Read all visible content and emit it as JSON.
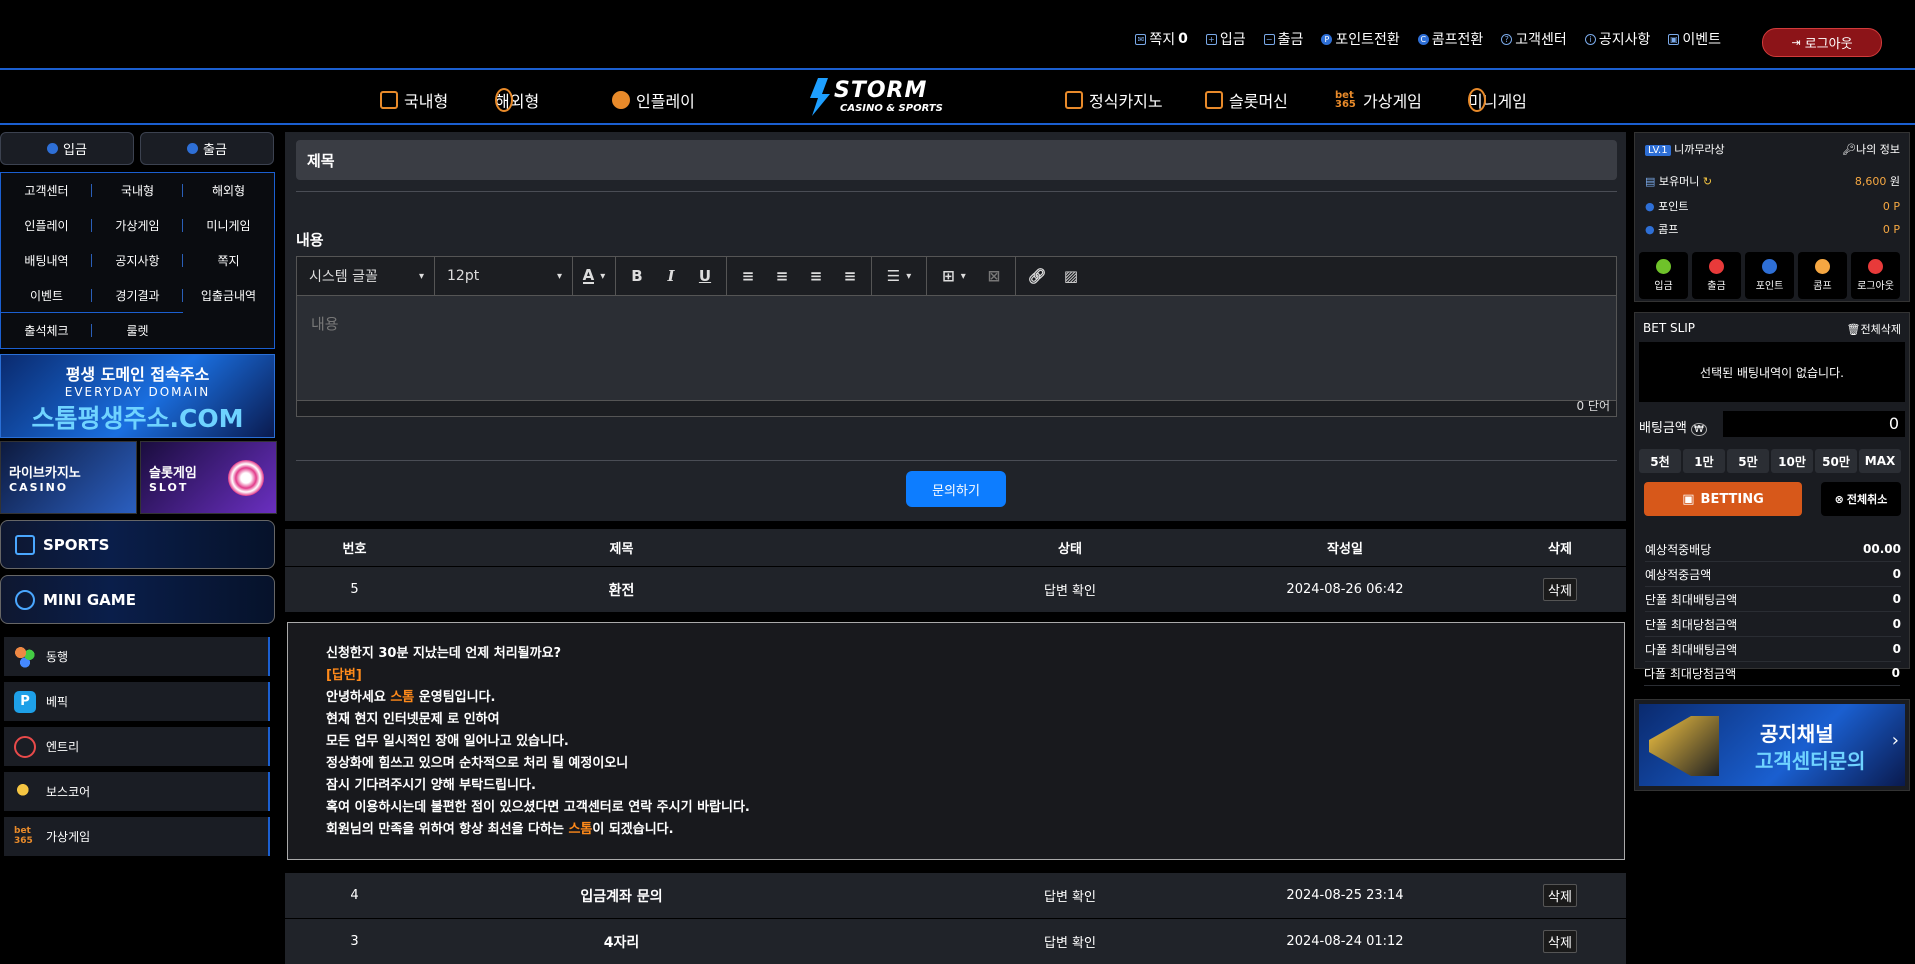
{
  "topnav": {
    "items": [
      {
        "label": "쪽지",
        "icon": "mail-icon",
        "count": "0"
      },
      {
        "label": "입금",
        "icon": "deposit-icon"
      },
      {
        "label": "출금",
        "icon": "withdraw-icon"
      },
      {
        "label": "포인트전환",
        "icon": "point-icon"
      },
      {
        "label": "콤프전환",
        "icon": "comp-icon"
      },
      {
        "label": "고객센터",
        "icon": "support-icon"
      },
      {
        "label": "공지사항",
        "icon": "notice-icon"
      },
      {
        "label": "이벤트",
        "icon": "gift-icon"
      }
    ],
    "logout_label": "로그아웃"
  },
  "mainnav": {
    "left": [
      {
        "label": "국내형"
      },
      {
        "label": "해외형"
      },
      {
        "label": "인플레이"
      }
    ],
    "right": [
      {
        "label": "정식카지노"
      },
      {
        "label": "슬롯머신"
      },
      {
        "label": "가상게임"
      },
      {
        "label": "미니게임"
      }
    ],
    "logo_main": "STORM",
    "logo_sub": "CASINO & SPORTS",
    "bet365": "bet 365"
  },
  "left": {
    "deposit": "입금",
    "withdraw": "출금",
    "grid": [
      "고객센터",
      "국내형",
      "해외형",
      "인플레이",
      "가상게임",
      "미니게임",
      "배팅내역",
      "공지사항",
      "쪽지",
      "이벤트",
      "경기결과",
      "입출금내역",
      "출석체크",
      "룰렛"
    ],
    "domain": {
      "line1": "평생 도메인 접속주소",
      "line2": "EVERYDAY DOMAIN",
      "line3": "스톰평생주소.COM"
    },
    "promo_casino": {
      "title": "라이브카지노",
      "sub": "CASINO"
    },
    "promo_slot": {
      "title": "슬롯게임",
      "sub": "SLOT"
    },
    "sports": "SPORTS",
    "minigame": "MINI GAME",
    "sites": [
      {
        "label": "동행"
      },
      {
        "label": "베픽"
      },
      {
        "label": "엔트리"
      },
      {
        "label": "보스코어"
      },
      {
        "label": "가상게임"
      }
    ]
  },
  "form": {
    "title_label": "제목",
    "content_label": "내용",
    "font_select": "시스템 글꼴",
    "size_select": "12pt",
    "placeholder": "내용",
    "wordcount": "0 단어",
    "submit": "문의하기"
  },
  "table": {
    "headers": [
      "번호",
      "제목",
      "상태",
      "작성일",
      "삭제"
    ],
    "rows": [
      {
        "no": "5",
        "title": "환전",
        "status": "답변 확인",
        "date": "2024-08-26 06:42",
        "del": "삭제"
      },
      {
        "no": "4",
        "title": "입금계좌 문의",
        "status": "답변 확인",
        "date": "2024-08-25 23:14",
        "del": "삭제"
      },
      {
        "no": "3",
        "title": "4자리",
        "status": "답변 확인",
        "date": "2024-08-24 01:12",
        "del": "삭제"
      }
    ],
    "answer": {
      "question": "신청한지 30분 지났는데 언제 처리될까요?",
      "tag": "[답변]",
      "l1_a": "안녕하세요 ",
      "l1_b": "스톰",
      "l1_c": " 운영팀입니다.",
      "l2": "현재 현지 인터넷문제 로 인하여",
      "l3": "모든 업무 일시적인 장애 일어나고 있습니다.",
      "l4": "정상화에 힘쓰고 있으며 순차적으로 처리 될 예정이오니",
      "l5": "잠시 기다려주시기 양해 부탁드립니다.",
      "l6": "혹여 이용하시는데 불편한 점이 있으셨다면 고객센터로 연락 주시기 바랍니다.",
      "l7_a": "회원님의 만족을 위하여 항상 최선을 다하는 ",
      "l7_b": "스톰",
      "l7_c": "이 되겠습니다."
    }
  },
  "account": {
    "level": "LV.1",
    "username": "니까무라상",
    "myinfo": "나의 정보",
    "money_label": "보유머니",
    "money_value": "8,600",
    "money_unit": "원",
    "point_label": "포인트",
    "point_value": "0",
    "point_unit": "P",
    "comp_label": "콤프",
    "comp_value": "0",
    "comp_unit": "P",
    "buttons": [
      "입금",
      "출금",
      "포인트",
      "콤프",
      "로그아웃"
    ]
  },
  "betslip": {
    "title": "BET SLIP",
    "clear": "전체삭제",
    "empty": "선택된 배팅내역이 없습니다.",
    "amount_label": "배팅금액",
    "amount_value": "0",
    "presets": [
      "5천",
      "1만",
      "5만",
      "10만",
      "50만",
      "MAX"
    ],
    "bet_button": "BETTING",
    "cancel_all": "전체취소",
    "stats": [
      {
        "label": "예상적중배당",
        "value": "00.00"
      },
      {
        "label": "예상적중금액",
        "value": "0"
      },
      {
        "label": "단폴 최대배팅금액",
        "value": "0"
      },
      {
        "label": "단폴 최대당첨금액",
        "value": "0"
      },
      {
        "label": "다폴 최대배팅금액",
        "value": "0"
      },
      {
        "label": "다폴 최대당첨금액",
        "value": "0"
      }
    ]
  },
  "notice_banner": {
    "line1": "공지채널",
    "line2": "고객센터문의"
  },
  "colors": {
    "accent": "#1b5fd0",
    "orange": "#ff8a1a",
    "panel": "#202329",
    "logout": "#8c1418"
  }
}
